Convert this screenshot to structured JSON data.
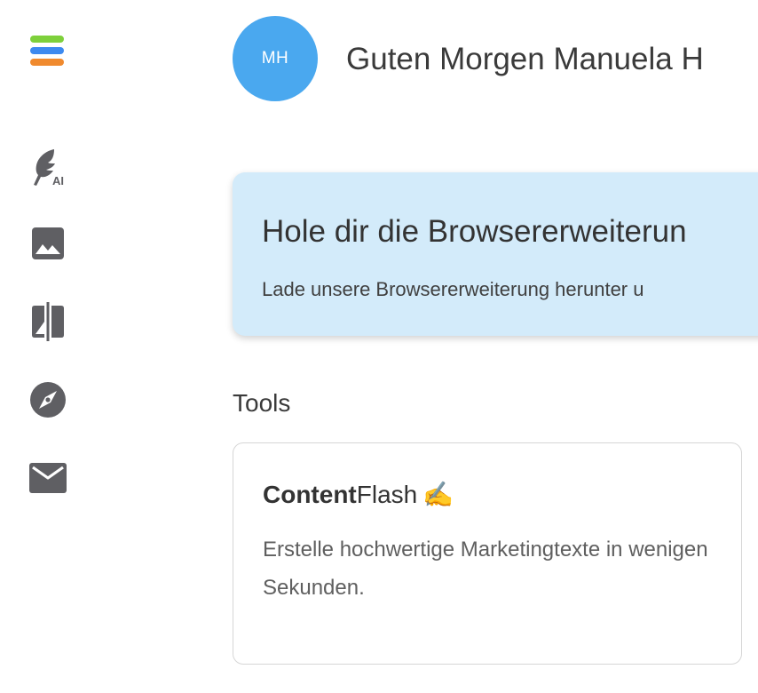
{
  "brand": {
    "logo_colors": [
      "#7ed03b",
      "#3d8af0",
      "#f08a2e"
    ]
  },
  "sidebar": {
    "icon_color": "#5f5f63",
    "items": [
      {
        "icon": "feather-ai-icon",
        "badge": "AI"
      },
      {
        "icon": "image-icon"
      },
      {
        "icon": "compare-icon"
      },
      {
        "icon": "compass-icon"
      },
      {
        "icon": "mail-icon"
      }
    ]
  },
  "header": {
    "avatar_initials": "MH",
    "avatar_color": "#4aa8ef",
    "greeting": "Guten Morgen Manuela H"
  },
  "banner": {
    "background": "#d3ebfa",
    "title": "Hole dir die Browsererweiterun",
    "text": "Lade unsere Browsererweiterung herunter u"
  },
  "tools": {
    "section_title": "Tools",
    "items": [
      {
        "title_bold": "Content",
        "title_rest": "Flash",
        "title_emoji": "✍️",
        "description": "Erstelle hochwertige Marketingtexte in wenigen Sekunden."
      }
    ]
  }
}
